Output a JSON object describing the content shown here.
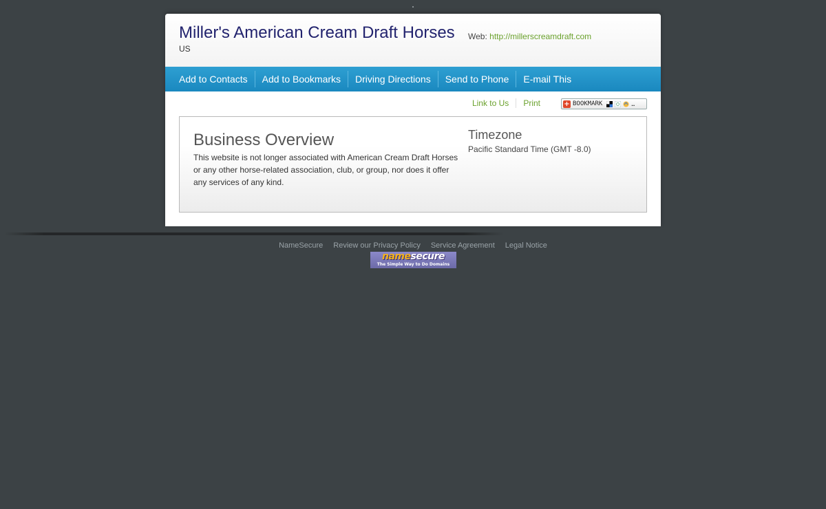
{
  "business": {
    "name": "Miller's American Cream Draft Horses",
    "country": "US",
    "web_label": "Web:",
    "web_url": "http://millerscreamdraft.com"
  },
  "nav": {
    "items": [
      {
        "label": "Add to Contacts"
      },
      {
        "label": "Add to Bookmarks"
      },
      {
        "label": "Driving Directions"
      },
      {
        "label": "Send to Phone"
      },
      {
        "label": "E-mail This"
      }
    ]
  },
  "tools": {
    "link_to_us": "Link to Us",
    "print": "Print",
    "bookmark_badge": "BOOKMARK"
  },
  "overview": {
    "heading": "Business Overview",
    "text": "This website is not longer associated with American Cream Draft Horses or any other horse-related association, club, or group, nor does it offer any services of any kind."
  },
  "timezone": {
    "heading": "Timezone",
    "value": "Pacific Standard Time (GMT -8.0)"
  },
  "footer": {
    "links": [
      {
        "label": "NameSecure"
      },
      {
        "label": "Review our Privacy Policy"
      },
      {
        "label": "Service Agreement"
      },
      {
        "label": "Legal Notice"
      }
    ],
    "logo_part1": "name",
    "logo_part2": "secure",
    "logo_tagline": "The Simple Way to Do Domains"
  },
  "colors": {
    "background": "#3c4245",
    "nav_blue": "#1a88bf",
    "title_navy": "#22236e",
    "link_green": "#6aa12c"
  }
}
